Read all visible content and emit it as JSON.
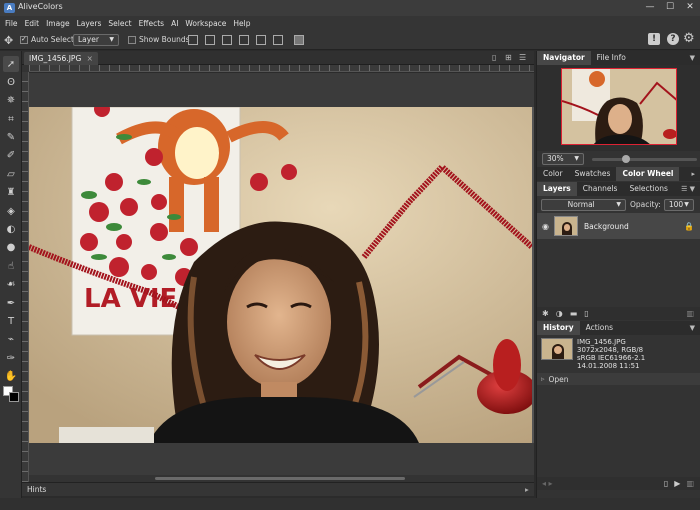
{
  "app": {
    "title": "AliveColors",
    "logo_letter": "A"
  },
  "window_controls": {
    "minimize": "—",
    "maximize": "☐",
    "close": "✕"
  },
  "menu": [
    "File",
    "Edit",
    "Image",
    "Layers",
    "Select",
    "Effects",
    "AI",
    "Workspace",
    "Help"
  ],
  "options_bar": {
    "auto_select_label": "Auto Select",
    "auto_select_checked": true,
    "auto_select_target": "Layer",
    "show_bounds_label": "Show Bounds",
    "show_bounds_checked": false
  },
  "document": {
    "tab_label": "IMG_1456.JPG",
    "tab_close": "×"
  },
  "hints": {
    "label": "Hints"
  },
  "navigator": {
    "tabs": [
      "Navigator",
      "File Info"
    ],
    "zoom": "30%"
  },
  "color_panel": {
    "tabs": [
      "Color",
      "Swatches",
      "Color Wheel"
    ]
  },
  "layers_panel": {
    "tabs": [
      "Layers",
      "Channels",
      "Selections"
    ],
    "blend_mode": "Normal",
    "opacity_label": "Opacity:",
    "opacity_value": "100",
    "layers": [
      {
        "name": "Background",
        "visible": true,
        "locked": true
      }
    ]
  },
  "history_panel": {
    "tabs": [
      "History",
      "Actions"
    ],
    "file_name": "IMG_1456.JPG",
    "file_info_1": "3072x2048, RGB/8",
    "file_info_2": "sRGB IEC61966-2.1",
    "file_date": "14.01.2008 11:51",
    "steps": [
      "Open"
    ]
  },
  "colors": {
    "accent": "#4a7cc0",
    "panel_bg": "#333333",
    "active_tab": "#474747"
  }
}
